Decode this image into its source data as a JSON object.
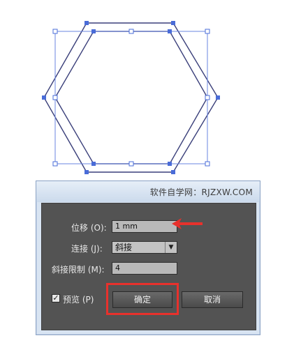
{
  "artboard": {
    "shape_color": "#4a6cd8"
  },
  "dialog": {
    "watermark": "软件自学网：RJZXW.COM",
    "offset": {
      "label": "位移 (O):",
      "value": "1 mm"
    },
    "joins": {
      "label": "连接 (J):",
      "value": "斜接",
      "arrow": "▼"
    },
    "miter_limit": {
      "label": "斜接限制 (M):",
      "value": "4"
    },
    "preview": {
      "label": "预览 (P)",
      "checked": true,
      "check_glyph": "✓"
    },
    "ok_label": "确定",
    "cancel_label": "取消"
  },
  "annotation": {
    "highlight_color": "#e8312c"
  }
}
